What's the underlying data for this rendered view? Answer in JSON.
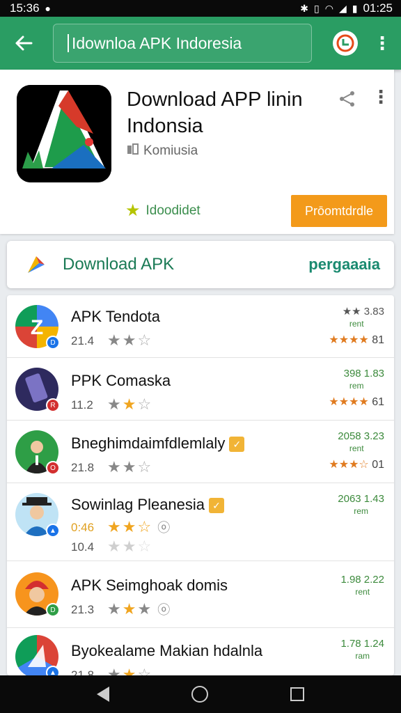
{
  "status_bar": {
    "time_left": "15:36",
    "time_right": "01:25"
  },
  "app_bar": {
    "search_text": "Idownloa APK  Indoresia"
  },
  "app_detail": {
    "title_line1": "Download APP linin",
    "title_line2": "Indonsia",
    "developer": "Komiusia",
    "wishlist_label": "Idoodidet",
    "install_label": "Prōomtdrdle"
  },
  "banner": {
    "title": "Download APK",
    "link": "pergaaaia"
  },
  "list": [
    {
      "title": "APK Tendota",
      "sub": "21.4",
      "meta_top": "★★ 3.83",
      "meta_mid": "rent",
      "meta_rating_stars": "★★★★",
      "meta_rating_value": "81"
    },
    {
      "title": "PPK Comaska",
      "sub": "11.2",
      "meta_top": "398 1.83",
      "meta_mid": "rem",
      "meta_rating_stars": "★★★★",
      "meta_rating_value": "61"
    },
    {
      "title": "Bneghimdaimfdlemlaly",
      "sub": "21.8",
      "meta_top": "2058 3.23",
      "meta_mid": "rent",
      "meta_rating_stars": "★★★☆",
      "meta_rating_value": "01"
    },
    {
      "title": "Sowinlag Pleanesia",
      "sub": "0:46",
      "sub2": "10.4",
      "meta_top": "2063 1.43",
      "meta_mid": "rem"
    },
    {
      "title": "APK Seimghoak domis",
      "sub": "21.3",
      "meta_top": "1.98 2.22",
      "meta_mid": "rent"
    },
    {
      "title": "Byokealame Makian hdalnla",
      "sub": "21.8",
      "meta_top": "1.78 1.24",
      "meta_mid": "ram"
    }
  ]
}
